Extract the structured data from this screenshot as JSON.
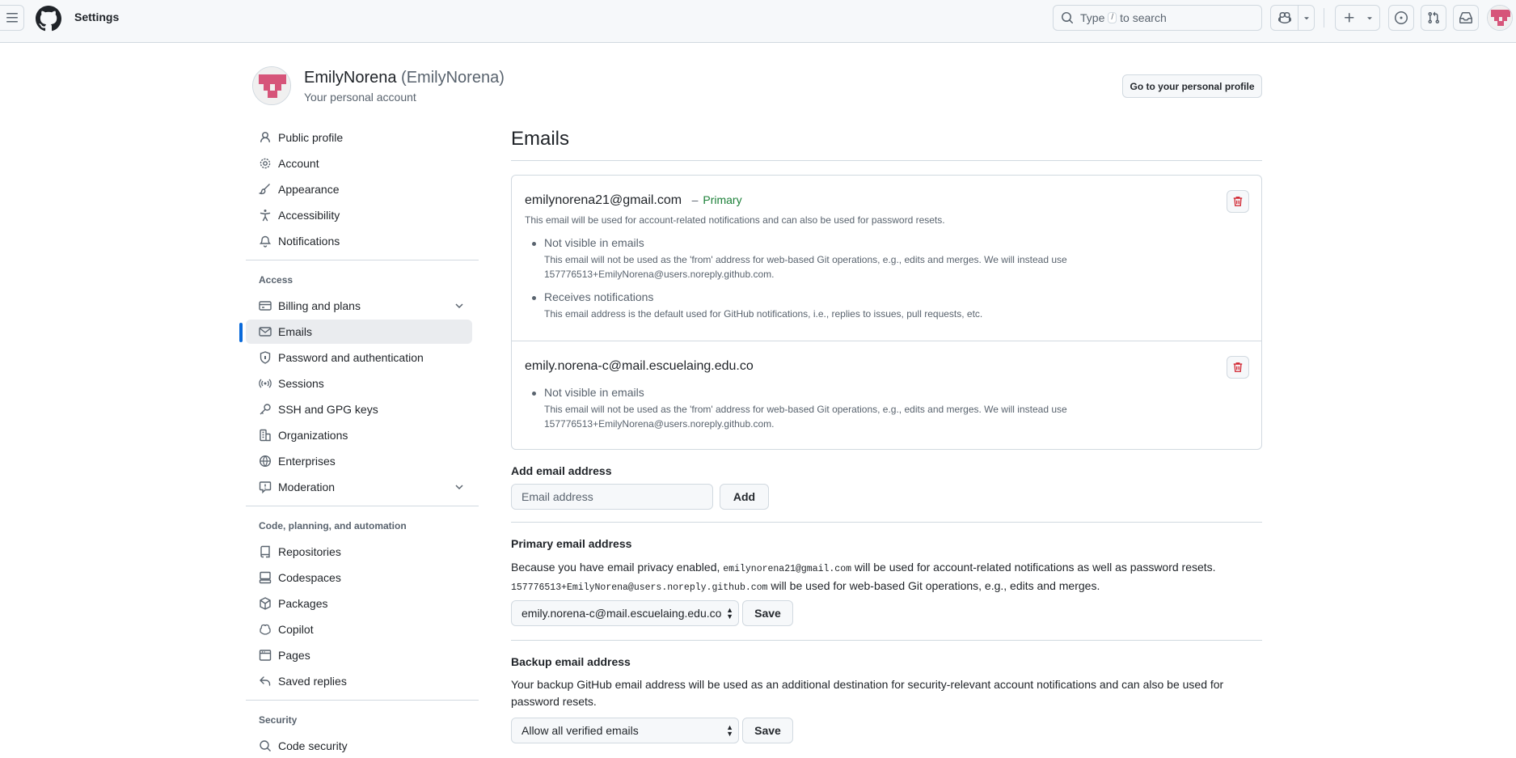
{
  "header": {
    "context_title": "Settings",
    "search_text_before": "Type",
    "search_key": "/",
    "search_text_after": "to search"
  },
  "account": {
    "display_name": "EmilyNorena",
    "login": "(EmilyNorena)",
    "subtitle": "Your personal account",
    "profile_button": "Go to your personal profile"
  },
  "sidebar": {
    "items_top": [
      {
        "label": "Public profile",
        "icon": "person-icon"
      },
      {
        "label": "Account",
        "icon": "gear-icon"
      },
      {
        "label": "Appearance",
        "icon": "paintbrush-icon"
      },
      {
        "label": "Accessibility",
        "icon": "accessibility-icon"
      },
      {
        "label": "Notifications",
        "icon": "bell-icon"
      }
    ],
    "access_heading": "Access",
    "items_access": [
      {
        "label": "Billing and plans",
        "icon": "credit-card-icon"
      },
      {
        "label": "Emails",
        "icon": "mail-icon"
      },
      {
        "label": "Password and authentication",
        "icon": "shield-lock-icon"
      },
      {
        "label": "Sessions",
        "icon": "broadcast-icon"
      },
      {
        "label": "SSH and GPG keys",
        "icon": "key-icon"
      },
      {
        "label": "Organizations",
        "icon": "organization-icon"
      },
      {
        "label": "Enterprises",
        "icon": "globe-icon"
      },
      {
        "label": "Moderation",
        "icon": "report-icon"
      }
    ],
    "code_heading": "Code, planning, and automation",
    "items_code": [
      {
        "label": "Repositories",
        "icon": "repo-icon"
      },
      {
        "label": "Codespaces",
        "icon": "codespaces-icon"
      },
      {
        "label": "Packages",
        "icon": "package-icon"
      },
      {
        "label": "Copilot",
        "icon": "copilot-icon"
      },
      {
        "label": "Pages",
        "icon": "browser-icon"
      },
      {
        "label": "Saved replies",
        "icon": "reply-icon"
      }
    ],
    "security_heading": "Security",
    "items_security": [
      {
        "label": "Code security",
        "icon": "codescan-icon"
      }
    ],
    "active_item": "Emails",
    "accent_color": "#0969da"
  },
  "main": {
    "title": "Emails",
    "emails": [
      {
        "address": "emilynorena21@gmail.com",
        "primary_dash": "–",
        "primary_label": "Primary",
        "description": "This email will be used for account-related notifications and can also be used for password resets.",
        "bullets": [
          {
            "title": "Not visible in emails",
            "desc": "This email will not be used as the 'from' address for web-based Git operations, e.g., edits and merges. We will instead use 157776513+EmilyNorena@users.noreply.github.com."
          },
          {
            "title": "Receives notifications",
            "desc": "This email address is the default used for GitHub notifications, i.e., replies to issues, pull requests, etc."
          }
        ]
      },
      {
        "address": "emily.norena-c@mail.escuelaing.edu.co",
        "bullets": [
          {
            "title": "Not visible in emails",
            "desc": "This email will not be used as the 'from' address for web-based Git operations, e.g., edits and merges. We will instead use 157776513+EmilyNorena@users.noreply.github.com."
          }
        ]
      }
    ],
    "add_email": {
      "label": "Add email address",
      "placeholder": "Email address",
      "button": "Add"
    },
    "primary_email": {
      "label": "Primary email address",
      "text_1": "Because you have email privacy enabled,",
      "code_1": "emilynorena21@gmail.com",
      "text_2": "will be used for account-related notifications as well as password resets.",
      "code_2": "157776513+EmilyNorena@users.noreply.github.com",
      "text_3": "will be used for web-based Git operations, e.g., edits and merges.",
      "selected": "emily.norena-c@mail.escuelaing.edu.co",
      "save": "Save"
    },
    "backup_email": {
      "label": "Backup email address",
      "description": "Your backup GitHub email address will be used as an additional destination for security-relevant account notifications and can also be used for password resets.",
      "selected": "Allow all verified emails",
      "save": "Save"
    }
  }
}
